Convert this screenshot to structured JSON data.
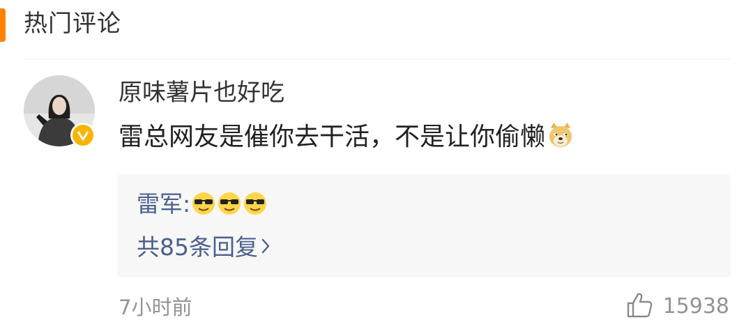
{
  "section": {
    "title": "热门评论"
  },
  "comment": {
    "username": "原味薯片也好吃",
    "text": "雷总网友是催你去干活，不是让你偷懒",
    "text_emoji": "doge-emoji",
    "time": "7小时前",
    "likes": "15938",
    "badge": "verified-badge-icon"
  },
  "reply": {
    "author": "雷军:",
    "emojis": [
      "sunglasses-emoji",
      "sunglasses-emoji",
      "sunglasses-emoji"
    ],
    "count_label": "共85条回复"
  },
  "colors": {
    "accent": "#ff8200",
    "link_blue": "#4a5f8c",
    "meta_gray": "#939393",
    "reply_bg": "#f7f7f7",
    "badge_gold": "#f7b500"
  }
}
